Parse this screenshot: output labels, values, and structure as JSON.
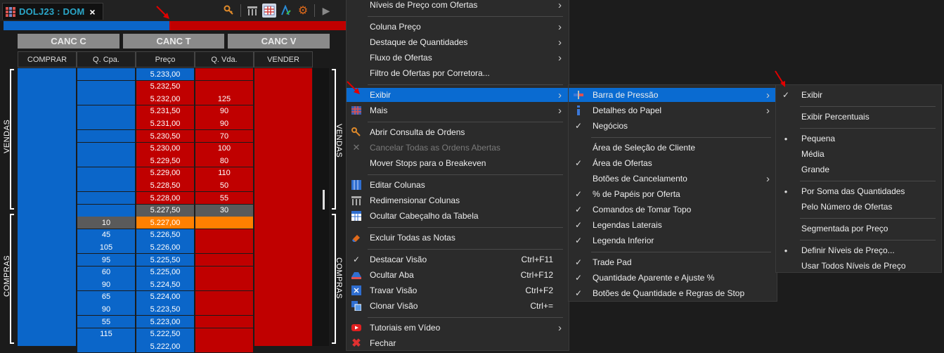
{
  "tab": {
    "title": "DOLJ23 : DOM",
    "close_icon": "×"
  },
  "toolbar": {
    "icons": [
      "key-icon",
      "columns-icon",
      "grid-icon",
      "font-color-icon",
      "gear-icon",
      "play-icon"
    ]
  },
  "pressure_bar": {
    "buy_fraction": 0.485,
    "buy_color": "#0b66c9",
    "sell_color": "#c00000"
  },
  "cancel_buttons": [
    "CANC C",
    "CANC T",
    "CANC V"
  ],
  "table": {
    "headers": [
      "COMPRAR",
      "Q. Cpa.",
      "Preço",
      "Q. Vda.",
      "VENDER"
    ],
    "rows": [
      {
        "q_cpa": "",
        "price": "5.233,00",
        "q_vda": "",
        "side": "buy-head"
      },
      {
        "q_cpa": "",
        "price": "5.232,50",
        "q_vda": "",
        "side": "sell"
      },
      {
        "q_cpa": "",
        "price": "5.232,00",
        "q_vda": "125",
        "side": "sell"
      },
      {
        "q_cpa": "",
        "price": "5.231,50",
        "q_vda": "90",
        "side": "sell"
      },
      {
        "q_cpa": "",
        "price": "5.231,00",
        "q_vda": "90",
        "side": "sell"
      },
      {
        "q_cpa": "",
        "price": "5.230,50",
        "q_vda": "70",
        "side": "sell"
      },
      {
        "q_cpa": "",
        "price": "5.230,00",
        "q_vda": "100",
        "side": "sell"
      },
      {
        "q_cpa": "",
        "price": "5.229,50",
        "q_vda": "80",
        "side": "sell"
      },
      {
        "q_cpa": "",
        "price": "5.229,00",
        "q_vda": "110",
        "side": "sell"
      },
      {
        "q_cpa": "",
        "price": "5.228,50",
        "q_vda": "50",
        "side": "sell"
      },
      {
        "q_cpa": "",
        "price": "5.228,00",
        "q_vda": "55",
        "side": "sell"
      },
      {
        "q_cpa": "",
        "price": "5.227,50",
        "q_vda": "30",
        "side": "best-ask"
      },
      {
        "q_cpa": "10",
        "price": "5.227,00",
        "q_vda": "",
        "side": "best-bid"
      },
      {
        "q_cpa": "45",
        "price": "5.226,50",
        "q_vda": "",
        "side": "buy"
      },
      {
        "q_cpa": "105",
        "price": "5.226,00",
        "q_vda": "",
        "side": "buy"
      },
      {
        "q_cpa": "95",
        "price": "5.225,50",
        "q_vda": "",
        "side": "buy"
      },
      {
        "q_cpa": "60",
        "price": "5.225,00",
        "q_vda": "",
        "side": "buy"
      },
      {
        "q_cpa": "90",
        "price": "5.224,50",
        "q_vda": "",
        "side": "buy"
      },
      {
        "q_cpa": "65",
        "price": "5.224,00",
        "q_vda": "",
        "side": "buy"
      },
      {
        "q_cpa": "90",
        "price": "5.223,50",
        "q_vda": "",
        "side": "buy"
      },
      {
        "q_cpa": "55",
        "price": "5.223,00",
        "q_vda": "",
        "side": "buy"
      },
      {
        "q_cpa": "115",
        "price": "5.222,50",
        "q_vda": "",
        "side": "buy"
      },
      {
        "q_cpa": "",
        "price": "5.222,00",
        "q_vda": "",
        "side": "buy"
      }
    ],
    "side_labels": {
      "sells": "VENDAS",
      "buys": "COMPRAS"
    },
    "colors": {
      "blue": "#0b66c9",
      "red": "#c00000",
      "orange": "#ff8000",
      "gray": "#5a5a5a"
    }
  },
  "main_menu": [
    {
      "label": "Níveis de Preço com Ofertas",
      "submenu": true
    },
    {
      "sep": true
    },
    {
      "label": "Coluna Preço",
      "submenu": true
    },
    {
      "label": "Destaque de Quantidades",
      "submenu": true
    },
    {
      "label": "Fluxo de Ofertas",
      "submenu": true
    },
    {
      "label": "Filtro de Ofertas por Corretora..."
    },
    {
      "sep": true
    },
    {
      "label": "Exibir",
      "submenu": true,
      "highlight": true
    },
    {
      "label": "Mais",
      "submenu": true,
      "icon": "grid-icon"
    },
    {
      "sep": true
    },
    {
      "label": "Abrir Consulta de Ordens",
      "icon": "key-icon"
    },
    {
      "label": "Cancelar Todas as Ordens Abertas",
      "icon": "cancel-icon",
      "disabled": true
    },
    {
      "label": "Mover Stops para o Breakeven"
    },
    {
      "sep": true
    },
    {
      "label": "Editar Colunas",
      "icon": "edit-columns-icon"
    },
    {
      "label": "Redimensionar Colunas",
      "icon": "resize-columns-icon"
    },
    {
      "label": "Ocultar Cabeçalho da Tabela",
      "icon": "table-header-icon"
    },
    {
      "sep": true
    },
    {
      "label": "Excluir Todas as Notas",
      "icon": "eraser-icon"
    },
    {
      "sep": true
    },
    {
      "label": "Destacar Visão",
      "shortcut": "Ctrl+F11",
      "check": true
    },
    {
      "label": "Ocultar Aba",
      "shortcut": "Ctrl+F12",
      "icon": "hide-tab-icon"
    },
    {
      "label": "Travar Visão",
      "shortcut": "Ctrl+F2",
      "icon": "lock-view-icon"
    },
    {
      "label": "Clonar Visão",
      "shortcut": "Ctrl+=",
      "icon": "clone-icon"
    },
    {
      "sep": true
    },
    {
      "label": "Tutoriais em Vídeo",
      "submenu": true,
      "icon": "youtube-icon"
    },
    {
      "label": "Fechar",
      "icon": "close-icon"
    }
  ],
  "exibir_menu": [
    {
      "label": "Barra de Pressão",
      "submenu": true,
      "highlight": true,
      "icon": "pressure-bar-icon"
    },
    {
      "label": "Detalhes do Papel",
      "submenu": true,
      "icon": "info-icon"
    },
    {
      "label": "Negócios",
      "check": true
    },
    {
      "sep": true
    },
    {
      "label": "Área de Seleção de Cliente"
    },
    {
      "label": "Área de Ofertas",
      "check": true
    },
    {
      "label": "Botões de Cancelamento",
      "submenu": true
    },
    {
      "label": "% de Papéis por Oferta",
      "check": true
    },
    {
      "label": "Comandos de Tomar Topo",
      "check": true
    },
    {
      "label": "Legendas Laterais",
      "check": true
    },
    {
      "label": "Legenda Inferior",
      "check": true
    },
    {
      "sep": true
    },
    {
      "label": "Trade Pad",
      "check": true
    },
    {
      "label": "Quantidade Aparente e Ajuste %",
      "check": true
    },
    {
      "label": "Botões de Quantidade e Regras de Stop",
      "check": true
    }
  ],
  "pressure_menu": [
    {
      "label": "Exibir",
      "check": true
    },
    {
      "sep": true
    },
    {
      "label": "Exibir Percentuais"
    },
    {
      "sep": true
    },
    {
      "label": "Pequena",
      "radio": true
    },
    {
      "label": "Média"
    },
    {
      "label": "Grande"
    },
    {
      "sep": true
    },
    {
      "label": "Por Soma das Quantidades",
      "radio": true
    },
    {
      "label": "Pelo Número de Ofertas"
    },
    {
      "sep": true
    },
    {
      "label": "Segmentada por Preço"
    },
    {
      "sep": true
    },
    {
      "label": "Definir Níveis de Preço...",
      "radio": true
    },
    {
      "label": "Usar Todos Níveis de Preço"
    }
  ]
}
